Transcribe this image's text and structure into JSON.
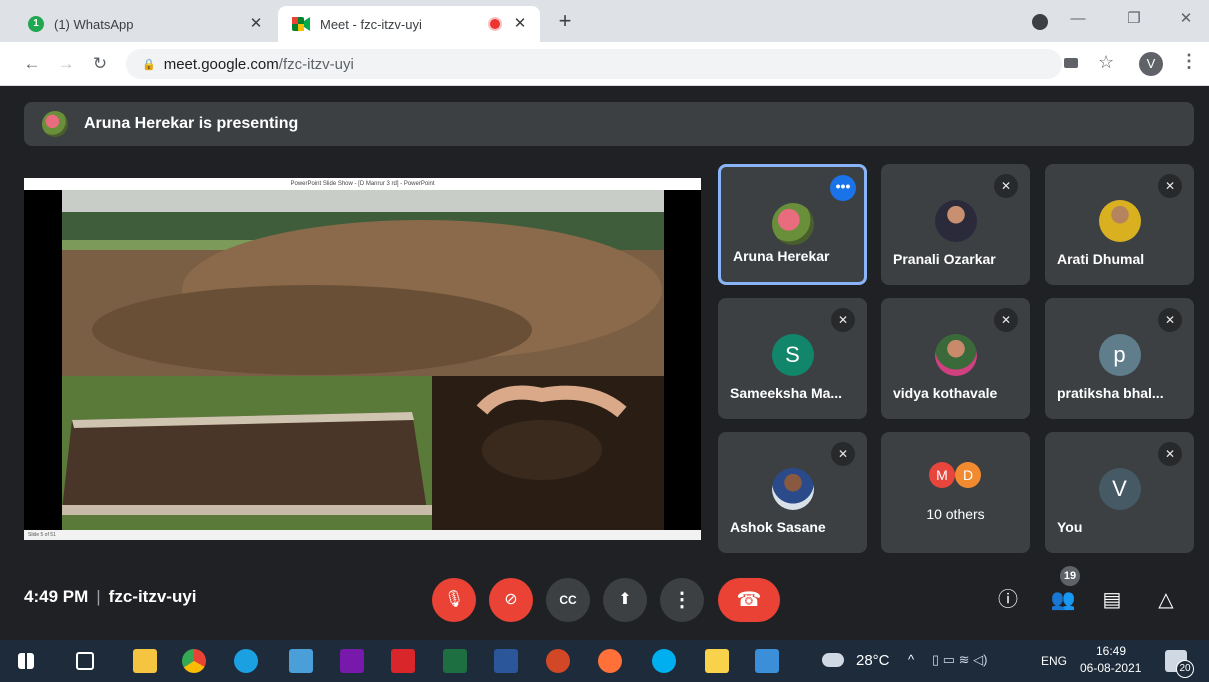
{
  "browser": {
    "tabs": [
      {
        "title": "(1) WhatsApp",
        "badge": "1"
      },
      {
        "title": "Meet - fzc-itzv-uyi"
      }
    ],
    "new_tab": "+",
    "url_host": "meet.google.com",
    "url_path": "/fzc-itzv-uyi",
    "profile_initial": "V"
  },
  "meet": {
    "presenting_banner": "Aruna Herekar is presenting",
    "slide_window_title": "PowerPoint Slide Show - [D Manrur 3 rd] - PowerPoint",
    "slide_counter": "Slide 5 of 51",
    "participants": [
      {
        "name": "Aruna Herekar",
        "active": true
      },
      {
        "name": "Pranali Ozarkar",
        "muted": true
      },
      {
        "name": "Arati Dhumal",
        "muted": true
      },
      {
        "name": "Sameeksha Ma...",
        "muted": true,
        "initial": "S",
        "color": "#12866b"
      },
      {
        "name": "vidya kothavale",
        "muted": true
      },
      {
        "name": "pratiksha bhal...",
        "muted": true,
        "initial": "p",
        "color": "#607d8b"
      },
      {
        "name": "Ashok Sasane",
        "muted": true
      },
      {
        "name": "10 others",
        "initials": [
          "M",
          "D"
        ]
      },
      {
        "name": "You",
        "muted": true,
        "initial": "V",
        "color": "#455a64"
      }
    ],
    "time": "4:49 PM",
    "meeting_code": "fzc-itzv-uyi",
    "people_count": "19"
  },
  "taskbar": {
    "weather": "28°C",
    "language": "ENG",
    "time": "16:49",
    "date": "06-08-2021",
    "notifications": "20"
  }
}
